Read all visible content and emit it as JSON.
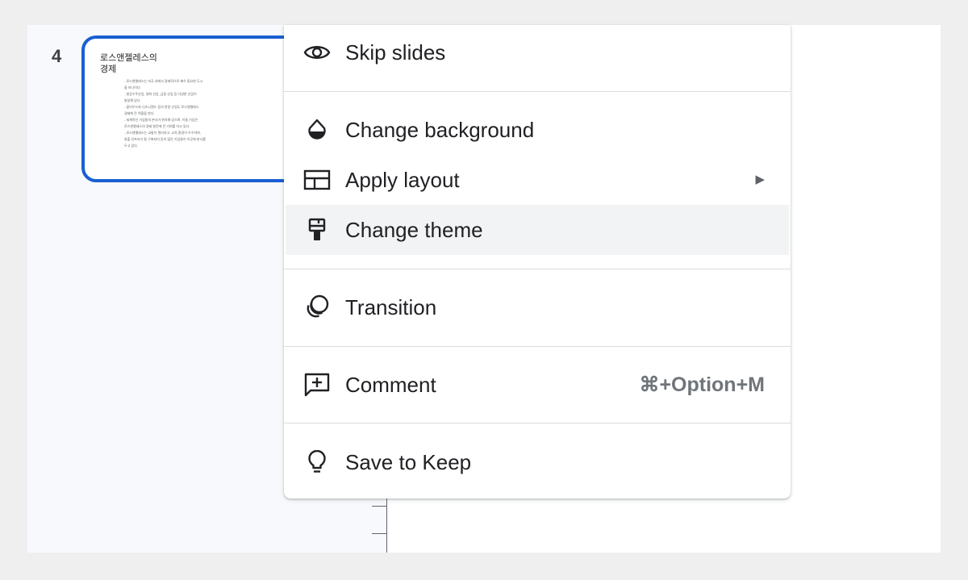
{
  "filmstrip": {
    "slide": {
      "number": "4",
      "title": "로스앤젤레스의\n경제",
      "body_lines": [
        "- 로스앤젤레스는 미국 내에서 경제적으로 매우 중요한 도시",
        "중 하나이다.",
        "- 항공우주산업, 영화 산업, 금융 산업 등 다양한 산업이",
        "발달해 있다.",
        "- 할리우드와 디즈니랜드 등의 관광 산업도 로스앤젤레스",
        "경제에 큰 역할을 한다.",
        "- 세계적인 기업들의 본사가 위치해 있으며, 이들 기업은",
        "로스앤젤레스의 경제 발전에 큰 기여를 하고 있다.",
        "- 로스앤젤레스는 교통이 편리하고, 교육 환경이 우수하여,",
        "창출 인프라가 잘 구축되어 있어 많은 기업들이 이곳에 본사를",
        "두고 있다."
      ]
    }
  },
  "menu": {
    "skip_slides": {
      "label": "Skip slides",
      "icon": "eye-icon"
    },
    "change_background": {
      "label": "Change background",
      "icon": "drop-icon"
    },
    "apply_layout": {
      "label": "Apply layout",
      "icon": "layout-icon",
      "arrow": "▶"
    },
    "change_theme": {
      "label": "Change theme",
      "icon": "paint-brush-icon"
    },
    "transition": {
      "label": "Transition",
      "icon": "transition-icon"
    },
    "comment": {
      "label": "Comment",
      "icon": "add-comment-icon",
      "shortcut": "⌘+Option+M"
    },
    "save_to_keep": {
      "label": "Save to Keep",
      "icon": "lightbulb-icon"
    }
  },
  "colors": {
    "accent_border": "#1a5fd2",
    "highlight": "#f1f3f4",
    "text": "#202124",
    "muted": "#70757a"
  }
}
